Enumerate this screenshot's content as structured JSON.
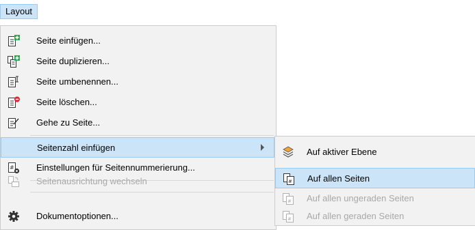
{
  "menubar": {
    "layout_label": "Layout"
  },
  "menu": {
    "items": [
      {
        "label": "Seite einfügen...",
        "icon": "insert-page-icon"
      },
      {
        "label": "Seite duplizieren...",
        "icon": "duplicate-page-icon"
      },
      {
        "label": "Seite umbenennen...",
        "icon": "rename-page-icon"
      },
      {
        "label": "Seite löschen...",
        "icon": "delete-page-icon"
      },
      {
        "label": "Gehe zu Seite...",
        "icon": "go-to-page-icon"
      },
      {
        "label": "Seitenzahl einfügen",
        "icon": ""
      },
      {
        "label": "Einstellungen für Seitennummerierung...",
        "icon": "page-numbering-settings-icon"
      },
      {
        "label": "Seitenausrichtung wechseln",
        "icon": "page-orientation-icon"
      },
      {
        "label": "Dokumentoptionen...",
        "icon": "gear-icon"
      }
    ]
  },
  "submenu": {
    "items": [
      {
        "label": "Auf aktiver Ebene",
        "icon": "layers-icon"
      },
      {
        "label": "Auf allen Seiten",
        "icon": "all-pages-icon"
      },
      {
        "label": "Auf allen ungeraden Seiten",
        "icon": "odd-pages-icon"
      },
      {
        "label": "Auf allen geraden Seiten",
        "icon": "even-pages-icon"
      }
    ]
  },
  "colors": {
    "highlight": "#cce4f7",
    "highlight_border": "#99cbf0",
    "menu_bg": "#f2f2f2",
    "disabled_text": "#a8a8a8",
    "accent_green": "#2fa84f",
    "accent_red": "#e0202a"
  }
}
